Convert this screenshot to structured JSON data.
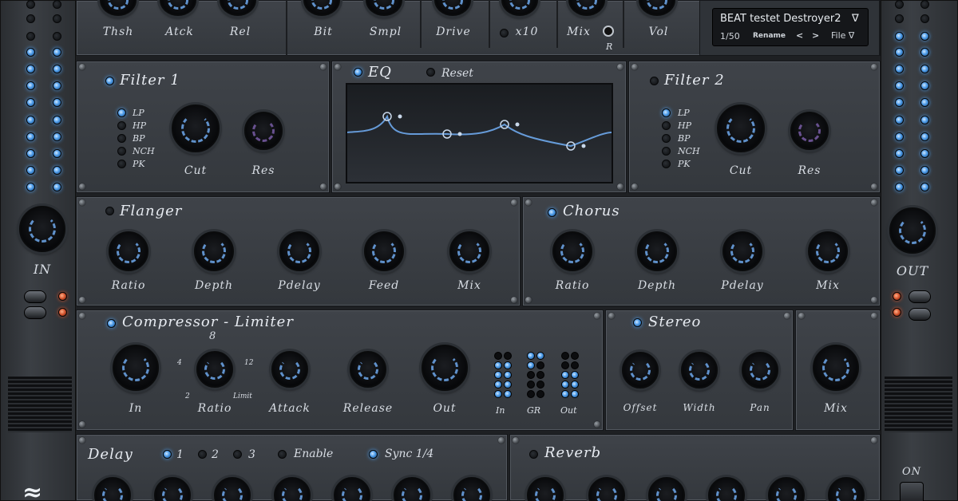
{
  "preset": {
    "name": "BEAT testet Destroyer2",
    "counter": "1/50",
    "rename_label": "Rename",
    "prev_label": "<",
    "next_label": ">",
    "file_label": "File ∇",
    "menu_arrow": "∇"
  },
  "top_row": {
    "labels": [
      "Thsh",
      "Atck",
      "Rel",
      "Bit",
      "Smpl",
      "Drive",
      "x10",
      "Mix",
      "Vol"
    ],
    "r_label": "R"
  },
  "filter1": {
    "title": "Filter 1",
    "modes": [
      "LP",
      "HP",
      "BP",
      "NCH",
      "PK"
    ],
    "cut_label": "Cut",
    "res_label": "Res"
  },
  "eq": {
    "title": "EQ",
    "reset_label": "Reset"
  },
  "filter2": {
    "title": "Filter 2",
    "modes": [
      "LP",
      "HP",
      "BP",
      "NCH",
      "PK"
    ],
    "cut_label": "Cut",
    "res_label": "Res"
  },
  "flanger": {
    "title": "Flanger",
    "knobs": [
      "Ratio",
      "Depth",
      "Pdelay",
      "Feed",
      "Mix"
    ]
  },
  "chorus": {
    "title": "Chorus",
    "knobs": [
      "Ratio",
      "Depth",
      "Pdelay",
      "Mix"
    ]
  },
  "compressor": {
    "title": "Compressor - Limiter",
    "in_label": "In",
    "ratio_label": "Ratio",
    "attack_label": "Attack",
    "release_label": "Release",
    "out_label": "Out",
    "ratio_marks": {
      "top": "8",
      "left": "4",
      "right": "12",
      "bottom_left": "2",
      "bottom_right": "Limit"
    },
    "meters": [
      "In",
      "GR",
      "Out"
    ]
  },
  "stereo": {
    "title": "Stereo",
    "knobs": [
      "Offset",
      "Width",
      "Pan"
    ]
  },
  "mix_panel": {
    "label": "Mix"
  },
  "delay": {
    "title": "Delay",
    "options": [
      "1",
      "2",
      "3"
    ],
    "enable_label": "Enable",
    "sync_label": "Sync 1/4"
  },
  "reverb": {
    "title": "Reverb"
  },
  "side": {
    "in_label": "IN",
    "out_label": "OUT",
    "on_label": "ON"
  },
  "colors": {
    "accent": "#4b9ae8",
    "panel": "#3a3e43",
    "red_led": "#d2502a"
  }
}
